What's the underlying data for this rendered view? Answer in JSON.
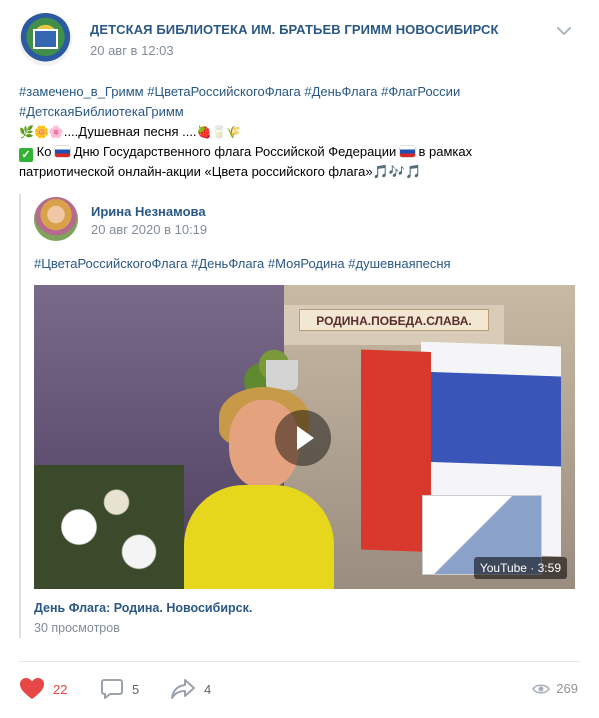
{
  "header": {
    "group_name": "ДЕТСКАЯ БИБЛИОТЕКА ИМ. БРАТЬЕВ ГРИММ НОВОСИБИРСК",
    "date": "20 авг в 12:03"
  },
  "post": {
    "tags_line1": "#замечено_в_Гримм #ЦветаРоссийскогоФлага #ДеньФлага #ФлагРоссии",
    "tags_line2": "#ДетскаяБиблиотекаГримм",
    "line3_prefix": "🌿🌼🌸",
    "line3_text": "....Душевная песня ....",
    "line3_suffix": "🍓🥛🌾",
    "line4_a": "Ко",
    "line4_b": "Дню Государственного флага Российской Федерации",
    "line4_c": "в рамках",
    "line5_text": "патриотической онлайн-акции «Цвета российского флага»",
    "line5_notes": "🎵🎶🎵"
  },
  "repost": {
    "author": "Ирина Незнамова",
    "date": "20 авг 2020 в 10:19",
    "tags": "#ЦветаРоссийскогоФлага #ДеньФлага #МояРодина #душевнаяпесня",
    "video": {
      "banner_text": "РОДИНА.ПОБЕДА.СЛАВА.",
      "duration_label": "YouTube · 3:59",
      "title": "День Флага: Родина. Новосибирск.",
      "views": "30 просмотров"
    }
  },
  "actions": {
    "likes": "22",
    "comments": "5",
    "shares": "4",
    "views": "269"
  },
  "colors": {
    "link": "#2a5885",
    "meta": "#818c99",
    "like": "#e64646"
  }
}
